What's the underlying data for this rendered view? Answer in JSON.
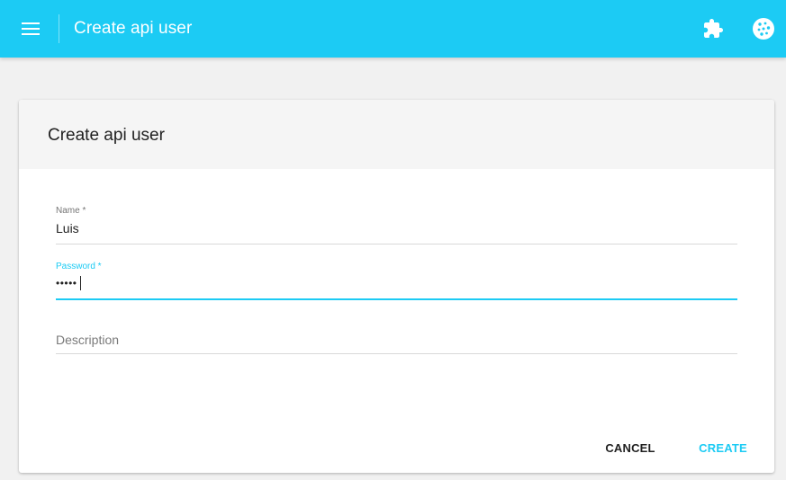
{
  "header": {
    "title": "Create api user",
    "icons": {
      "menu": "menu-icon",
      "plugins": "puzzle-icon",
      "account": "cookie-icon"
    },
    "colors": {
      "accent": "#1ccbf4"
    }
  },
  "card": {
    "title": "Create api user"
  },
  "form": {
    "name": {
      "label": "Name *",
      "value": "Luis"
    },
    "password": {
      "label": "Password *",
      "masked_value": "•••••"
    },
    "description": {
      "placeholder": "Description",
      "value": ""
    }
  },
  "actions": {
    "cancel_label": "CANCEL",
    "create_label": "CREATE"
  }
}
